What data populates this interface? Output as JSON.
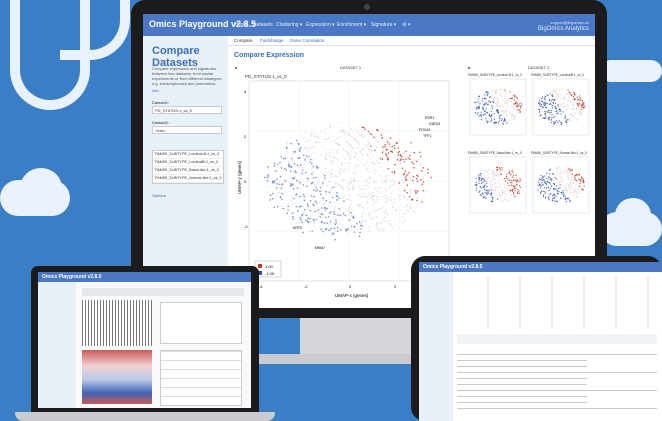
{
  "app": {
    "brand": "Omics Playground v2.8.5",
    "nav_items": [
      "Home",
      "Datasets",
      "Clustering ▾",
      "Expression ▾",
      "Enrichment ▾",
      "Signature ▾",
      "⚙ ▾"
    ],
    "user_line1": "support@bigomics.ch",
    "user_line2": "BigOmics Analytics"
  },
  "sidebar": {
    "title": "Compare Datasets",
    "description": "Compare expression and signatures between two datasets, from similar experiments or from different datatypes, e.g. transcriptomics and proteomics.",
    "info_link": "Info",
    "dataset1_label": "Dataset1:",
    "dataset1_value": "PD_STATUS:1_vs_0",
    "dataset2_label": "Dataset2:",
    "dataset2_value": "<this>",
    "dataset2_options": [
      "PAM50_SUBTYPE_Luminal.B:1_vs_0",
      "PAM50_SUBTYPE_LuminalB:1_vs_0",
      "PAM50_SUBTYPE_Basal-like:1_vs_0",
      "PAM50_SUBTYPE_Normal-like:1_vs_0"
    ],
    "options_link": "Options"
  },
  "tabs": [
    "Compare",
    "Foldchange",
    "Gene Correlation"
  ],
  "main": {
    "title": "Compare Expression",
    "panel_a_label": "a",
    "panel_b_label": "b",
    "dataset1_header": "DATASET 1",
    "dataset2_header": "DATASET 2",
    "plot_a_title": "PD_STATUS:1_vs_0",
    "x_axis_label": "UMAP-x (genes)",
    "y_axis_label": "UMAP-y (genes)",
    "legend_high": "1.00",
    "legend_low": "-1.00",
    "x_ticks": [
      "-4",
      "-2",
      "0",
      "2",
      "4"
    ],
    "y_ticks": [
      "4",
      "2",
      "0",
      "-2",
      "-4"
    ],
    "gene_labels": [
      "ESR1",
      "GATA3",
      "FOXA1",
      "TFF1",
      "MKI67",
      "KRT5"
    ],
    "small_plot_titles": [
      "PAM50_SUBTYPE_Luminal.B:1_vs_0",
      "PAM50_SUBTYPE_LuminalB:1_vs_0",
      "PAM50_SUBTYPE_Basal-like:1_vs_0",
      "PAM50_SUBTYPE_Normal-like:1_vs_0"
    ]
  },
  "laptop": {
    "brand": "Omics Playground v2.8.5"
  },
  "tablet": {
    "brand": "Omics Playground v2.8.5"
  },
  "colors": {
    "background": "#3a7fc6",
    "navbar": "#4a78c4",
    "sidebar": "#e8f0f8",
    "accent": "#3c6fb6",
    "high": "#c0392b",
    "low": "#2e4fa0"
  }
}
